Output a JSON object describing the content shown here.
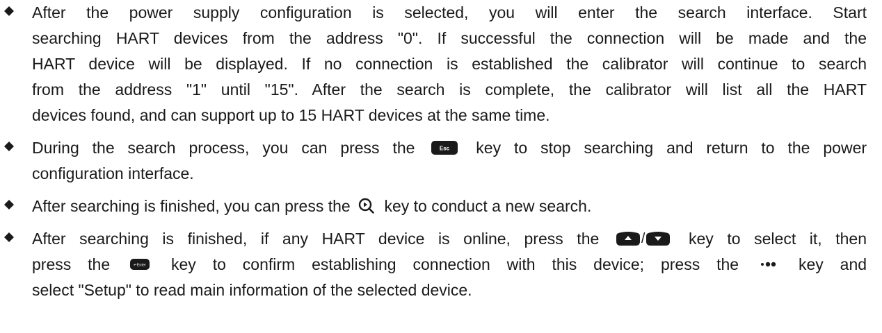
{
  "bullets": [
    {
      "lines": [
        "After the power supply configuration is selected, you will enter the search interface. Start",
        "searching HART devices from the address \"0\". If successful the connection will be made and the",
        "HART device will be displayed. If no connection is established the calibrator will continue to search",
        "from the address \"1\" until \"15\". After the search is complete, the calibrator will list all the HART",
        "devices found, and can support up to 15 HART devices at the same time."
      ]
    },
    {
      "line1_before": "During the search process, you can press the",
      "line1_after": "key to stop searching and return to the power",
      "line2": "configuration interface.",
      "key_icon": "esc-key-icon",
      "key_label": "Esc"
    },
    {
      "before": "After searching is finished, you can press the",
      "after": "key to conduct a new search.",
      "key_icon": "search-key-icon"
    },
    {
      "line1_before": "After searching is finished, if any HART device is online, press the",
      "line1_slash": "/",
      "line1_after": "key to select it, then",
      "line2_a": "press the",
      "line2_b": "key to confirm establishing connection with this device; press the",
      "line2_c": "key and",
      "line3": "select \"Setup\" to read main information of the selected device.",
      "up_key_icon": "up-arrow-key-icon",
      "down_key_icon": "down-arrow-key-icon",
      "enter_key_icon": "enter-key-icon",
      "enter_key_label": "↵Enter",
      "more_key_icon": "more-key-icon"
    }
  ],
  "colors": {
    "text": "#1a1a1a",
    "key_fill": "#1a1a1a",
    "key_label": "#ffffff"
  }
}
